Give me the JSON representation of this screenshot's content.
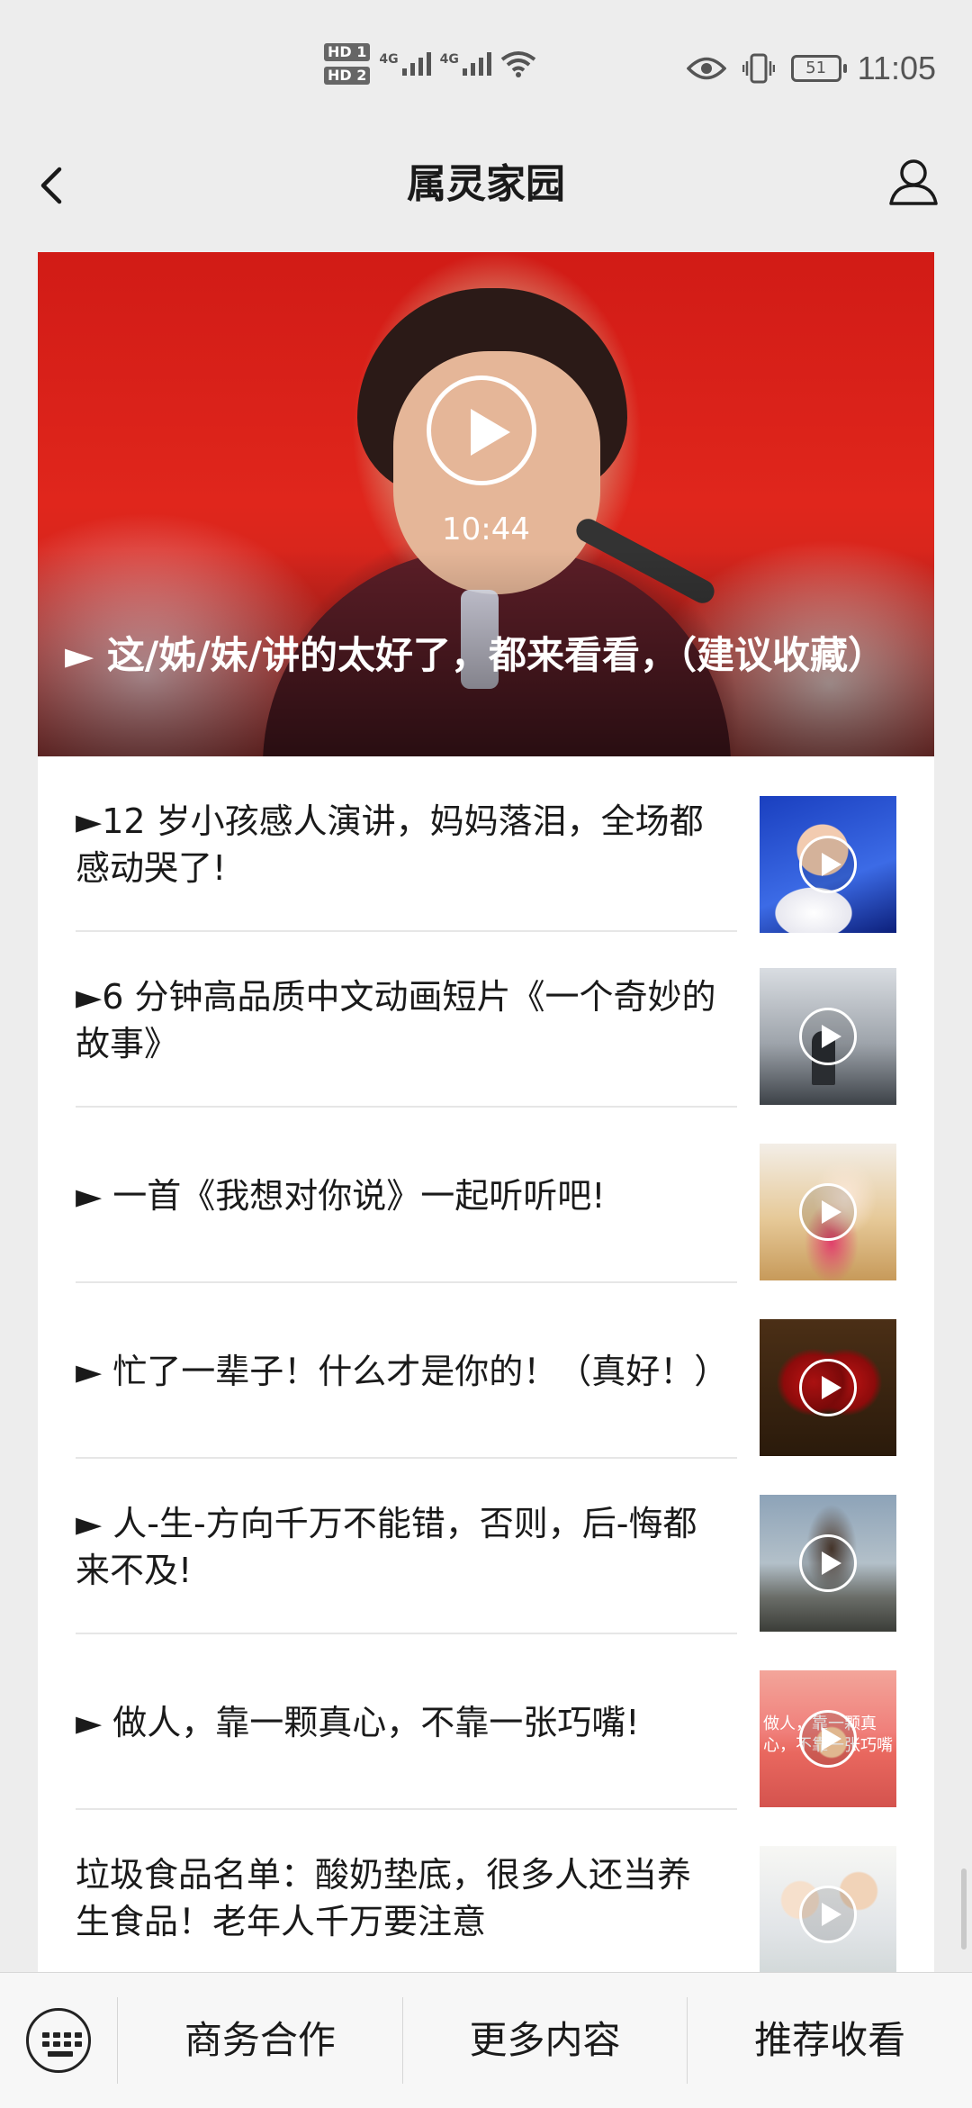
{
  "status_bar": {
    "time": "11:05",
    "battery": "51",
    "hd1": "HD 1",
    "hd2": "HD 2",
    "net1": "4G",
    "net2": "4G"
  },
  "nav": {
    "title": "属灵家园",
    "back_icon": "chevron-left-icon",
    "profile_icon": "user-icon"
  },
  "hero": {
    "duration": "10:44",
    "title": "► 这/姊/妹/讲的太好了，都来看看，（建议收藏）"
  },
  "articles": [
    {
      "title": "►12 岁小孩感人演讲，妈妈落泪，全场都感动哭了!"
    },
    {
      "title": "►6 分钟高品质中文动画短片《一个奇妙的故事》"
    },
    {
      "title": "► 一首《我想对你说》一起听听吧!"
    },
    {
      "title": "► 忙了一辈子！什么才是你的！（真好！）"
    },
    {
      "title": "► 人-生-方向千万不能错，否则，后-悔都来不及!"
    },
    {
      "title": "► 做人，靠一颗真心，不靠一张巧嘴!"
    },
    {
      "title": "垃圾食品名单：酸奶垫底，很多人还当养生食品！老年人千万要注意"
    }
  ],
  "thumb_texts": {
    "t6": "做人，靠一颗真心，不靠一张巧嘴"
  },
  "bottom_menu": {
    "keyboard_icon": "keyboard-icon",
    "items": [
      "商务合作",
      "更多内容",
      "推荐收看"
    ]
  },
  "colors": {
    "background": "#ededed",
    "card": "#ffffff",
    "text": "#1a1a1a"
  }
}
